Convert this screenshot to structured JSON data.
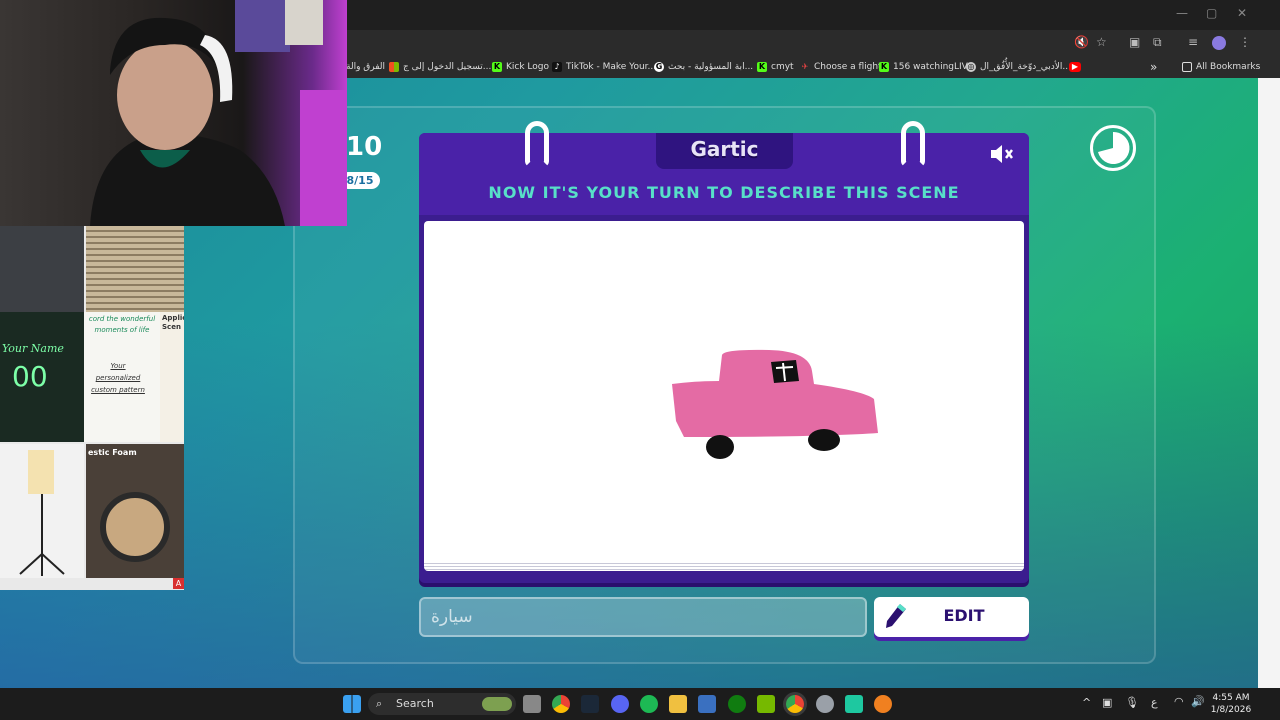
{
  "browser": {
    "bookmarks": [
      "الفرق والة",
      "تسجيل الدخول إلى ج...",
      "Kick Logo",
      "TikTok - Make Your...",
      "ابة المسؤولية - بحث...",
      "cmyt",
      "Choose a flight",
      "156 watchingLIVE",
      "الأدبي_دوّخة_الأُفُق_ال..."
    ],
    "all_bookmarks": "All Bookmarks",
    "bookmark_more": "»"
  },
  "game": {
    "round_number": "10",
    "round_progress": "8/15",
    "logo": "Gartic",
    "heading": "NOW IT'S YOUR TURN TO DESCRIBE THIS SCENE",
    "answer_value": "سيارة",
    "edit_label": "EDIT",
    "colors": {
      "heading": "#58e0c8",
      "book": "#4a22a8",
      "car": "#e46ba4"
    }
  },
  "ads": {
    "shirt_text": "Your Name",
    "shirt_number": "00",
    "card_heading": "cord the wonderful moments of life",
    "card_body": "Your personalized custom pattern",
    "applic": "Applic Scen",
    "foam": "estic Foam",
    "badge": "A"
  },
  "taskbar": {
    "search_label": "Search",
    "lang": "ع",
    "time": "4:55 AM",
    "date": "1/8/2026"
  }
}
